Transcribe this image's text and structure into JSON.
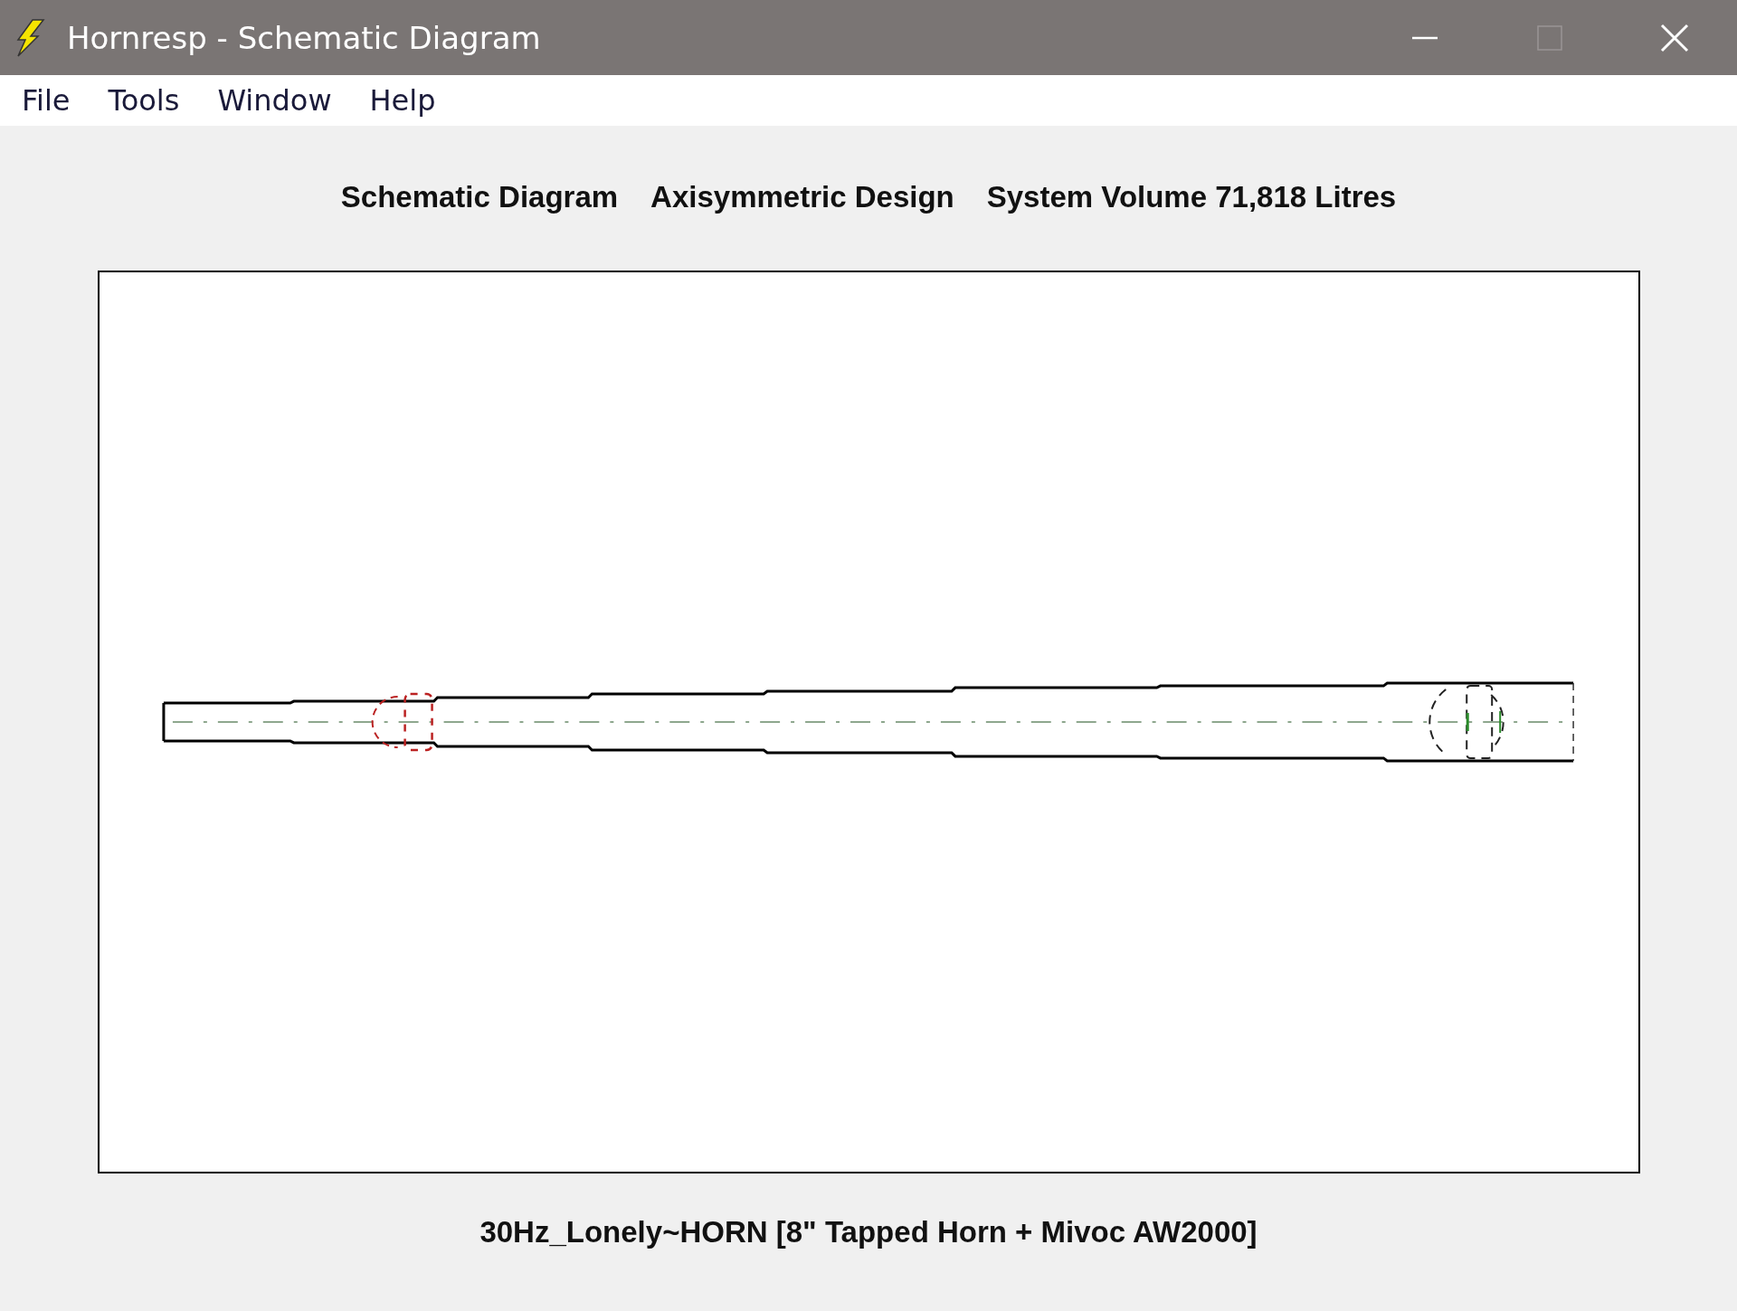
{
  "window": {
    "title": "Hornresp - Schematic Diagram"
  },
  "menu": [
    "File",
    "Tools",
    "Window",
    "Help"
  ],
  "header": [
    "Schematic Diagram",
    "Axisymmetric Design",
    "System Volume 71,818 Litres"
  ],
  "footer": "30Hz_Lonely~HORN [8\" Tapped Horn + Mivoc AW2000]"
}
